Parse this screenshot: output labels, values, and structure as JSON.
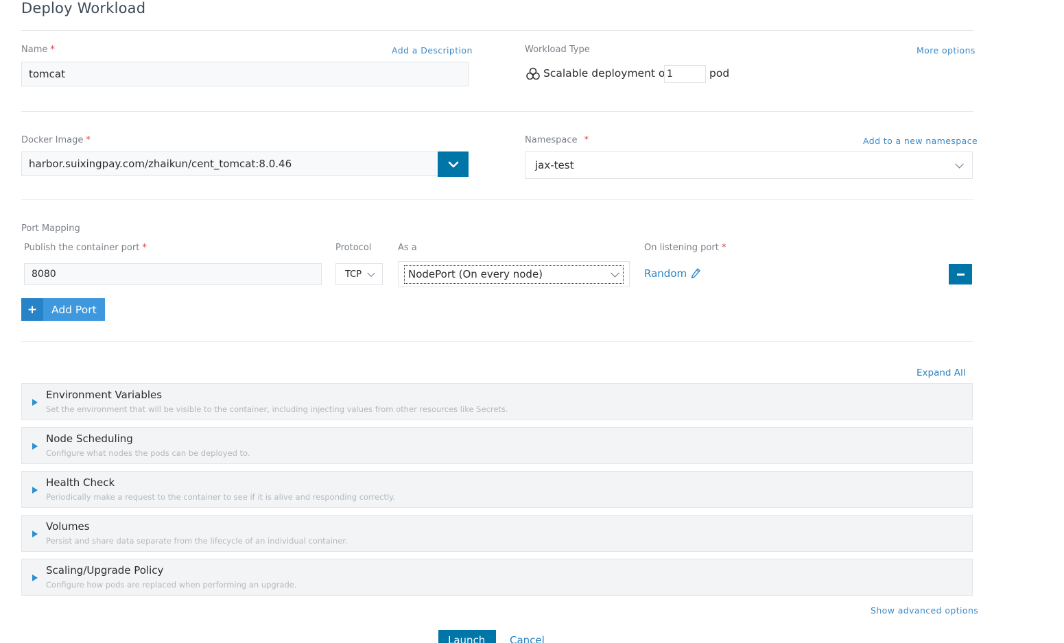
{
  "page": {
    "title": "Deploy Workload"
  },
  "name_field": {
    "label": "Name",
    "required_mark": "*",
    "value": "tomcat",
    "add_description_link": "Add a Description"
  },
  "workload_type": {
    "label": "Workload Type",
    "more_options_link": "More options",
    "prefix": "Scalable deployment of",
    "pod_count": "1",
    "suffix": "pod"
  },
  "docker_image": {
    "label": "Docker Image",
    "required_mark": "*",
    "value": "harbor.suixingpay.com/zhaikun/cent_tomcat:8.0.46"
  },
  "namespace": {
    "label": "Namespace",
    "required_mark": "*",
    "add_link": "Add to a new namespace",
    "value": "jax-test"
  },
  "port_mapping": {
    "section_label": "Port Mapping",
    "columns": {
      "publish": "Publish the container port",
      "protocol": "Protocol",
      "as_a": "As a",
      "listening": "On listening port"
    },
    "required_mark": "*",
    "row": {
      "container_port": "8080",
      "protocol": "TCP",
      "as_a": "NodePort (On every node)",
      "listening_port": "Random"
    },
    "add_port_label": "Add Port"
  },
  "expand_all_link": "Expand All",
  "sections": [
    {
      "title": "Environment Variables",
      "desc": "Set the environment that will be visible to the container, including injecting values from other resources like Secrets."
    },
    {
      "title": "Node Scheduling",
      "desc": "Configure what nodes the pods can be deployed to."
    },
    {
      "title": "Health Check",
      "desc": "Periodically make a request to the container to see if it is alive and responding correctly."
    },
    {
      "title": "Volumes",
      "desc": "Persist and share data separate from the lifecycle of an individual container."
    },
    {
      "title": "Scaling/Upgrade Policy",
      "desc": "Configure how pods are replaced when performing an upgrade."
    }
  ],
  "show_advanced_link": "Show advanced options",
  "footer": {
    "launch_label": "Launch",
    "cancel_label": "Cancel"
  }
}
